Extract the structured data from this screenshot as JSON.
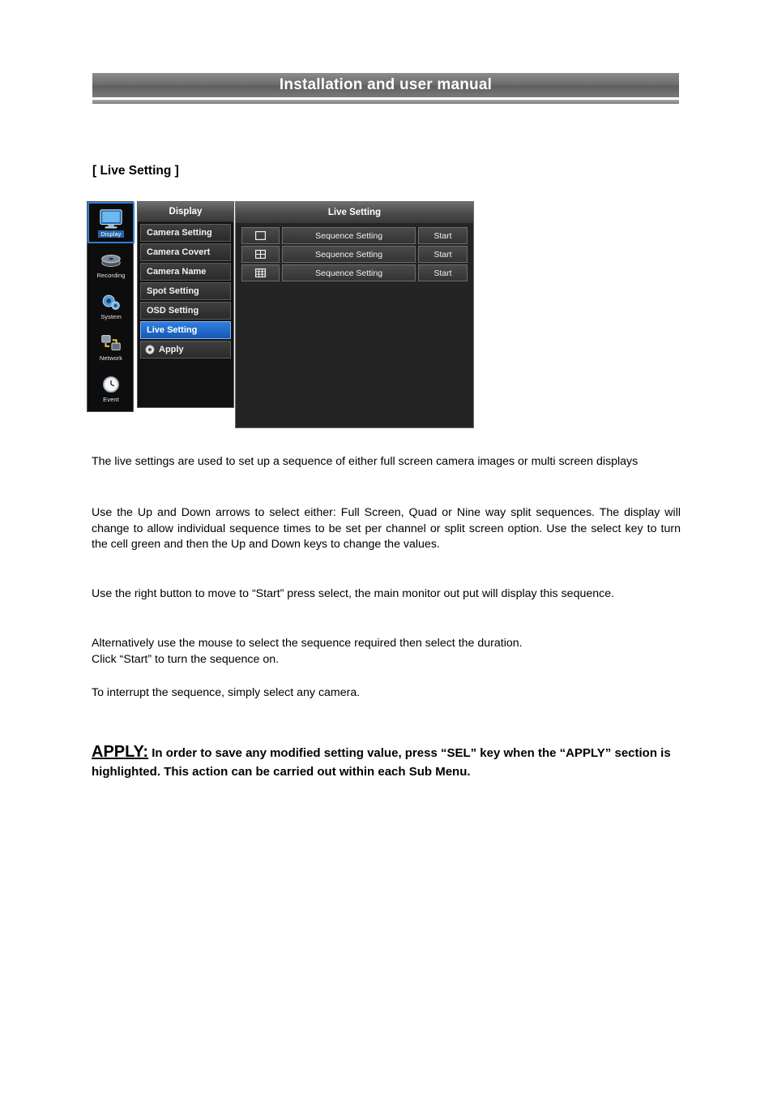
{
  "header": {
    "title": "Installation and user manual"
  },
  "section": {
    "title": "[ Live Setting ]"
  },
  "osd": {
    "rail": [
      {
        "label": "Display",
        "icon": "monitor-icon",
        "selected": true
      },
      {
        "label": "Recording",
        "icon": "discs-icon",
        "selected": false
      },
      {
        "label": "System",
        "icon": "gears-icon",
        "selected": false
      },
      {
        "label": "Network",
        "icon": "network-icon",
        "selected": false
      },
      {
        "label": "Event",
        "icon": "clock-icon",
        "selected": false
      }
    ],
    "menu": {
      "title": "Display",
      "items": [
        {
          "label": "Camera Setting",
          "active": false
        },
        {
          "label": "Camera Covert",
          "active": false
        },
        {
          "label": "Camera Name",
          "active": false
        },
        {
          "label": "Spot Setting",
          "active": false
        },
        {
          "label": "OSD Setting",
          "active": false
        },
        {
          "label": "Live Setting",
          "active": true
        },
        {
          "label": "Apply",
          "active": false,
          "icon": "apply-gear-icon"
        }
      ]
    },
    "panel": {
      "title": "Live Setting",
      "rows": [
        {
          "icon": "single-screen-icon",
          "sequence_label": "Sequence Setting",
          "start_label": "Start"
        },
        {
          "icon": "quad-screen-icon",
          "sequence_label": "Sequence Setting",
          "start_label": "Start"
        },
        {
          "icon": "nine-screen-icon",
          "sequence_label": "Sequence Setting",
          "start_label": "Start"
        }
      ]
    }
  },
  "body": {
    "p1": "The live settings are used to set up a sequence of either full screen camera images or multi screen displays",
    "p2": "Use the Up and Down arrows to select either:  Full Screen, Quad or Nine way split sequences. The display will change to allow individual sequence times to be set per channel or split screen option. Use the select key to turn the cell green and then the Up and Down keys to change the values.",
    "p3": "Use the right button to move to “Start” press select, the main monitor out put will display this sequence.",
    "p4": "Alternatively use the mouse to select the sequence required then select the duration.\nClick “Start” to turn the sequence on.",
    "p5": "To interrupt the sequence, simply select any camera.",
    "apply_word": "APPLY:",
    "apply_text": " In order to save any modified setting value, press “SEL” key when the “APPLY” section is highlighted. This action can be carried out within each Sub Menu."
  },
  "colors": {
    "accent": "#2f7fe0",
    "header_gray": "#6e6e6e"
  }
}
